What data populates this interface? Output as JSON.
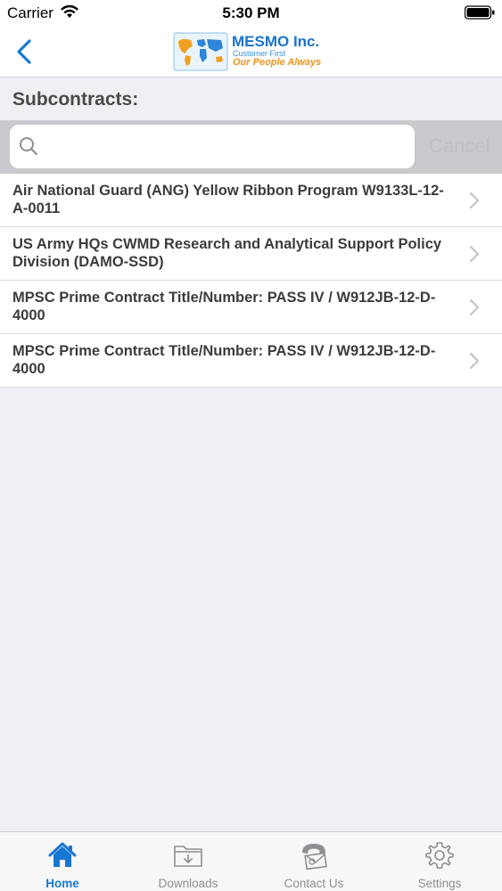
{
  "status_bar": {
    "carrier": "Carrier",
    "time": "5:30 PM"
  },
  "nav": {
    "logo_title": "MESMO Inc.",
    "logo_tagline_1": "Customer First",
    "logo_tagline_2": "Our People Always"
  },
  "section": {
    "title": "Subcontracts:"
  },
  "search": {
    "placeholder": "",
    "value": "",
    "cancel_label": "Cancel"
  },
  "list": {
    "items": [
      {
        "label": "Air National Guard (ANG) Yellow Ribbon Program W9133L-12-A-0011"
      },
      {
        "label": "US Army HQs CWMD Research and Analytical Support Policy Division (DAMO-SSD)"
      },
      {
        "label": "MPSC Prime Contract Title/Number: PASS IV / W912JB-12-D-4000"
      },
      {
        "label": "MPSC Prime Contract Title/Number: PASS IV / W912JB-12-D-4000"
      }
    ]
  },
  "tabs": [
    {
      "label": "Home",
      "icon": "home-icon",
      "active": true
    },
    {
      "label": "Downloads",
      "icon": "downloads-folder-icon",
      "active": false
    },
    {
      "label": "Contact Us",
      "icon": "contact-phone-icon",
      "active": false
    },
    {
      "label": "Settings",
      "icon": "gear-icon",
      "active": false
    }
  ],
  "colors": {
    "accent": "#1877d2",
    "brand_blue": "#1a73c9",
    "brand_orange": "#e8961e",
    "background": "#efeff4",
    "search_bar_bg": "#c9c9ce",
    "tab_inactive": "#8e8e93"
  }
}
